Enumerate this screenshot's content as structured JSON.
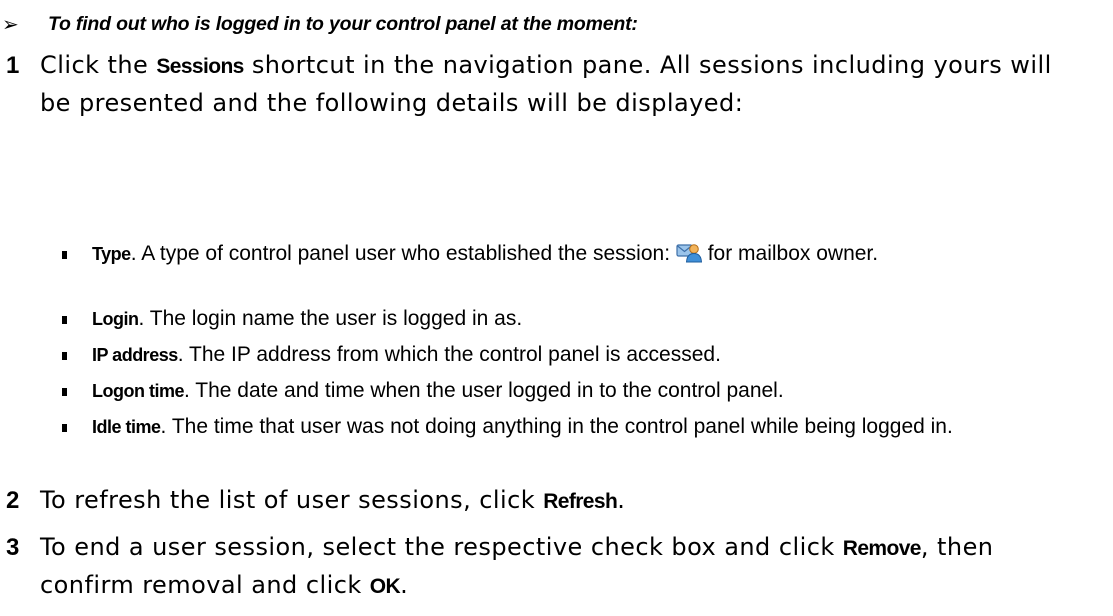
{
  "heading": {
    "arrow": "➢",
    "text": "To find out who is logged in to your control panel at the moment:"
  },
  "step1": {
    "number": "1",
    "pre": "Click the ",
    "bold": "Sessions",
    "post": " shortcut in the navigation pane. All sessions including yours will be presented and the following details will be displayed:"
  },
  "details": [
    {
      "term": "Type",
      "text": ". A type of control panel user who established the session: ",
      "icon": "mailbox-owner-icon",
      "text_after": " for mailbox owner."
    },
    {
      "term": "Login",
      "text": ". The login name the user is logged in as."
    },
    {
      "term": "IP address",
      "text": ". The IP address from which the control panel is accessed."
    },
    {
      "term": "Logon time",
      "text": ". The date and time when the user logged in to the control panel."
    },
    {
      "term": "Idle time",
      "text": ". The time that user was not doing anything in the control panel while being logged in."
    }
  ],
  "step2": {
    "number": "2",
    "pre": "To refresh the list of user sessions, click ",
    "bold": "Refresh",
    "post": "."
  },
  "step3": {
    "number": "3",
    "pre": "To end a user session, select the respective check box and click ",
    "bold1": "Remove",
    "mid": ", then confirm removal and click ",
    "bold2": "OK",
    "post": "."
  }
}
